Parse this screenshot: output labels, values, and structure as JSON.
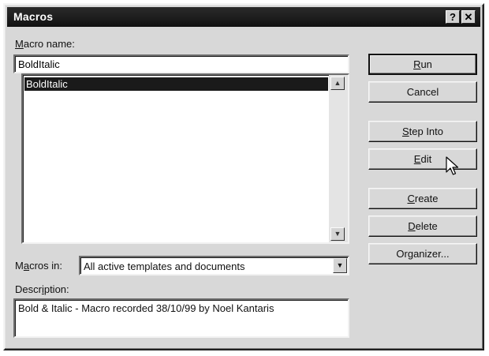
{
  "window": {
    "title": "Macros"
  },
  "titlebar": {
    "help_glyph": "?",
    "close_glyph": "✕"
  },
  "macro_name": {
    "label_accel": "M",
    "label_rest": "acro name:",
    "value": "BoldItalic"
  },
  "macro_list": {
    "items": [
      "BoldItalic"
    ],
    "selected_index": 0,
    "scroll_up_icon": "up-arrow-icon",
    "scroll_down_icon": "down-arrow-icon"
  },
  "buttons": {
    "run": {
      "accel": "R",
      "rest": "un"
    },
    "cancel": {
      "label": "Cancel"
    },
    "step_into": {
      "accel": "S",
      "rest": "tep Into"
    },
    "edit": {
      "accel": "E",
      "rest": "dit"
    },
    "create": {
      "accel": "C",
      "rest": "reate"
    },
    "delete": {
      "accel": "D",
      "rest": "elete"
    },
    "organizer": {
      "pre": "Or",
      "accel": "g",
      "rest": "anizer..."
    }
  },
  "macros_in": {
    "label_pre": "M",
    "label_accel": "a",
    "label_rest": "cros in:",
    "value": "All active templates and documents"
  },
  "description": {
    "label_pre": "Descr",
    "label_accel": "i",
    "label_rest": "ption:",
    "text": "Bold & Italic - Macro recorded 38/10/99 by Noel Kantaris"
  },
  "colors": {
    "titlebar": "#111111",
    "dialog_face": "#d8d8d8",
    "selection": "#1a1a1a"
  }
}
